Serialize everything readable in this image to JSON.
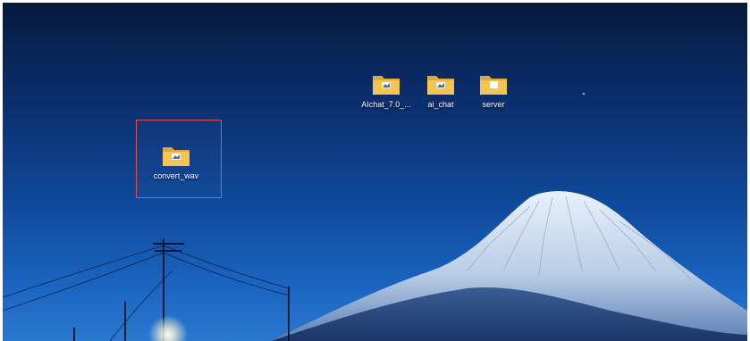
{
  "desktop": {
    "icons": [
      {
        "label": "AIchat_7.0_...",
        "icon": "folder-icon"
      },
      {
        "label": "ai_chat",
        "icon": "folder-icon"
      },
      {
        "label": "server",
        "icon": "folder-icon"
      },
      {
        "label": "convert_wav",
        "icon": "folder-icon",
        "selected": true
      }
    ],
    "colors": {
      "selection_border": "#e2544f",
      "folder_yellow": "#f3c04b",
      "sky_dark": "#071a3e",
      "sky_light": "#2b78d0"
    }
  }
}
